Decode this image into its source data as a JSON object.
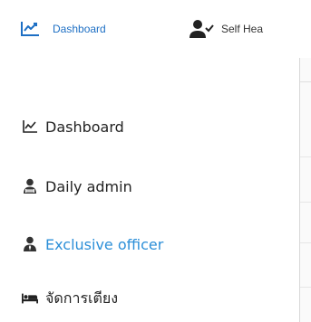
{
  "topbar": {
    "dashboard_label": "Dashboard",
    "self_label": "Self Hea",
    "accent_color": "#1d6fc4"
  },
  "menu": {
    "items": [
      {
        "label": "Dashboard",
        "icon": "line-chart-icon"
      },
      {
        "label": "Daily admin",
        "icon": "user-tie-icon"
      },
      {
        "label": "Exclusive officer",
        "icon": "user-tie-icon",
        "active": true
      },
      {
        "label": "จัดการเตียง",
        "icon": "bed-icon"
      }
    ],
    "active_color": "#2c8fd8"
  }
}
